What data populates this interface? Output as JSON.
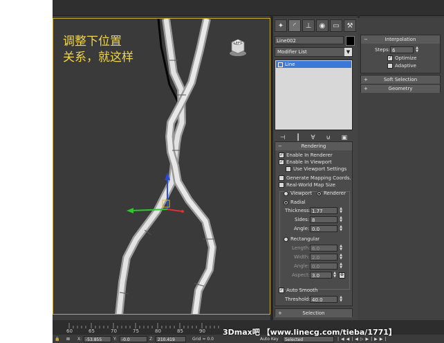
{
  "viewport": {
    "caption": "调整下位置\n关系，就这样",
    "viewcube_label": "LEFT"
  },
  "command_panel": {
    "object_name": "Line002",
    "modifier_list": "Modifier List",
    "stack_item": "Line",
    "tabs": [
      "create-icon",
      "modify-icon",
      "hierarchy-icon",
      "motion-icon",
      "display-icon",
      "utilities-icon"
    ],
    "rendering": {
      "title": "Rendering",
      "enable_in_renderer": "Enable In Renderer",
      "enable_in_viewport": "Enable In Viewport",
      "use_viewport_settings": "Use Viewport Settings",
      "generate_mapping": "Generate Mapping Coords.",
      "real_world_map": "Real-World Map Size",
      "viewport_radio": "Viewport",
      "renderer_radio": "Renderer",
      "radial": "Radial",
      "thickness_label": "Thickness:",
      "thickness_value": "1.77",
      "sides_label": "Sides:",
      "sides_value": "8",
      "angle_label": "Angle:",
      "angle_value": "0.0",
      "rectangular": "Rectangular",
      "length_label": "Length:",
      "length_value": "6.0",
      "width_label": "Width:",
      "width_value": "2.0",
      "rect_angle_label": "Angle:",
      "rect_angle_value": "0.0",
      "aspect_label": "Aspect:",
      "aspect_value": "3.0",
      "auto_smooth": "Auto Smooth",
      "threshold_label": "Threshold:",
      "threshold_value": "40.0"
    },
    "selection_title": "Selection"
  },
  "right_panel": {
    "interpolation_title": "Interpolation",
    "steps_label": "Steps:",
    "steps_value": "6",
    "optimize": "Optimize",
    "adaptive": "Adaptive",
    "soft_selection": "Soft Selection",
    "geometry": "Geometry"
  },
  "timeline": {
    "ticks": [
      "60",
      "65",
      "70",
      "75",
      "80",
      "85",
      "90"
    ]
  },
  "status": {
    "x_label": "X:",
    "x_value": "-53.855",
    "y_label": "Y:",
    "y_value": "-0.0",
    "z_label": "Z:",
    "z_value": "210.419",
    "grid": "Grid = 0.0",
    "auto_key": "Auto Key",
    "selected": "Selected"
  },
  "watermark": "3Dmax吧  【www.linecg.com/tieba/1771】"
}
